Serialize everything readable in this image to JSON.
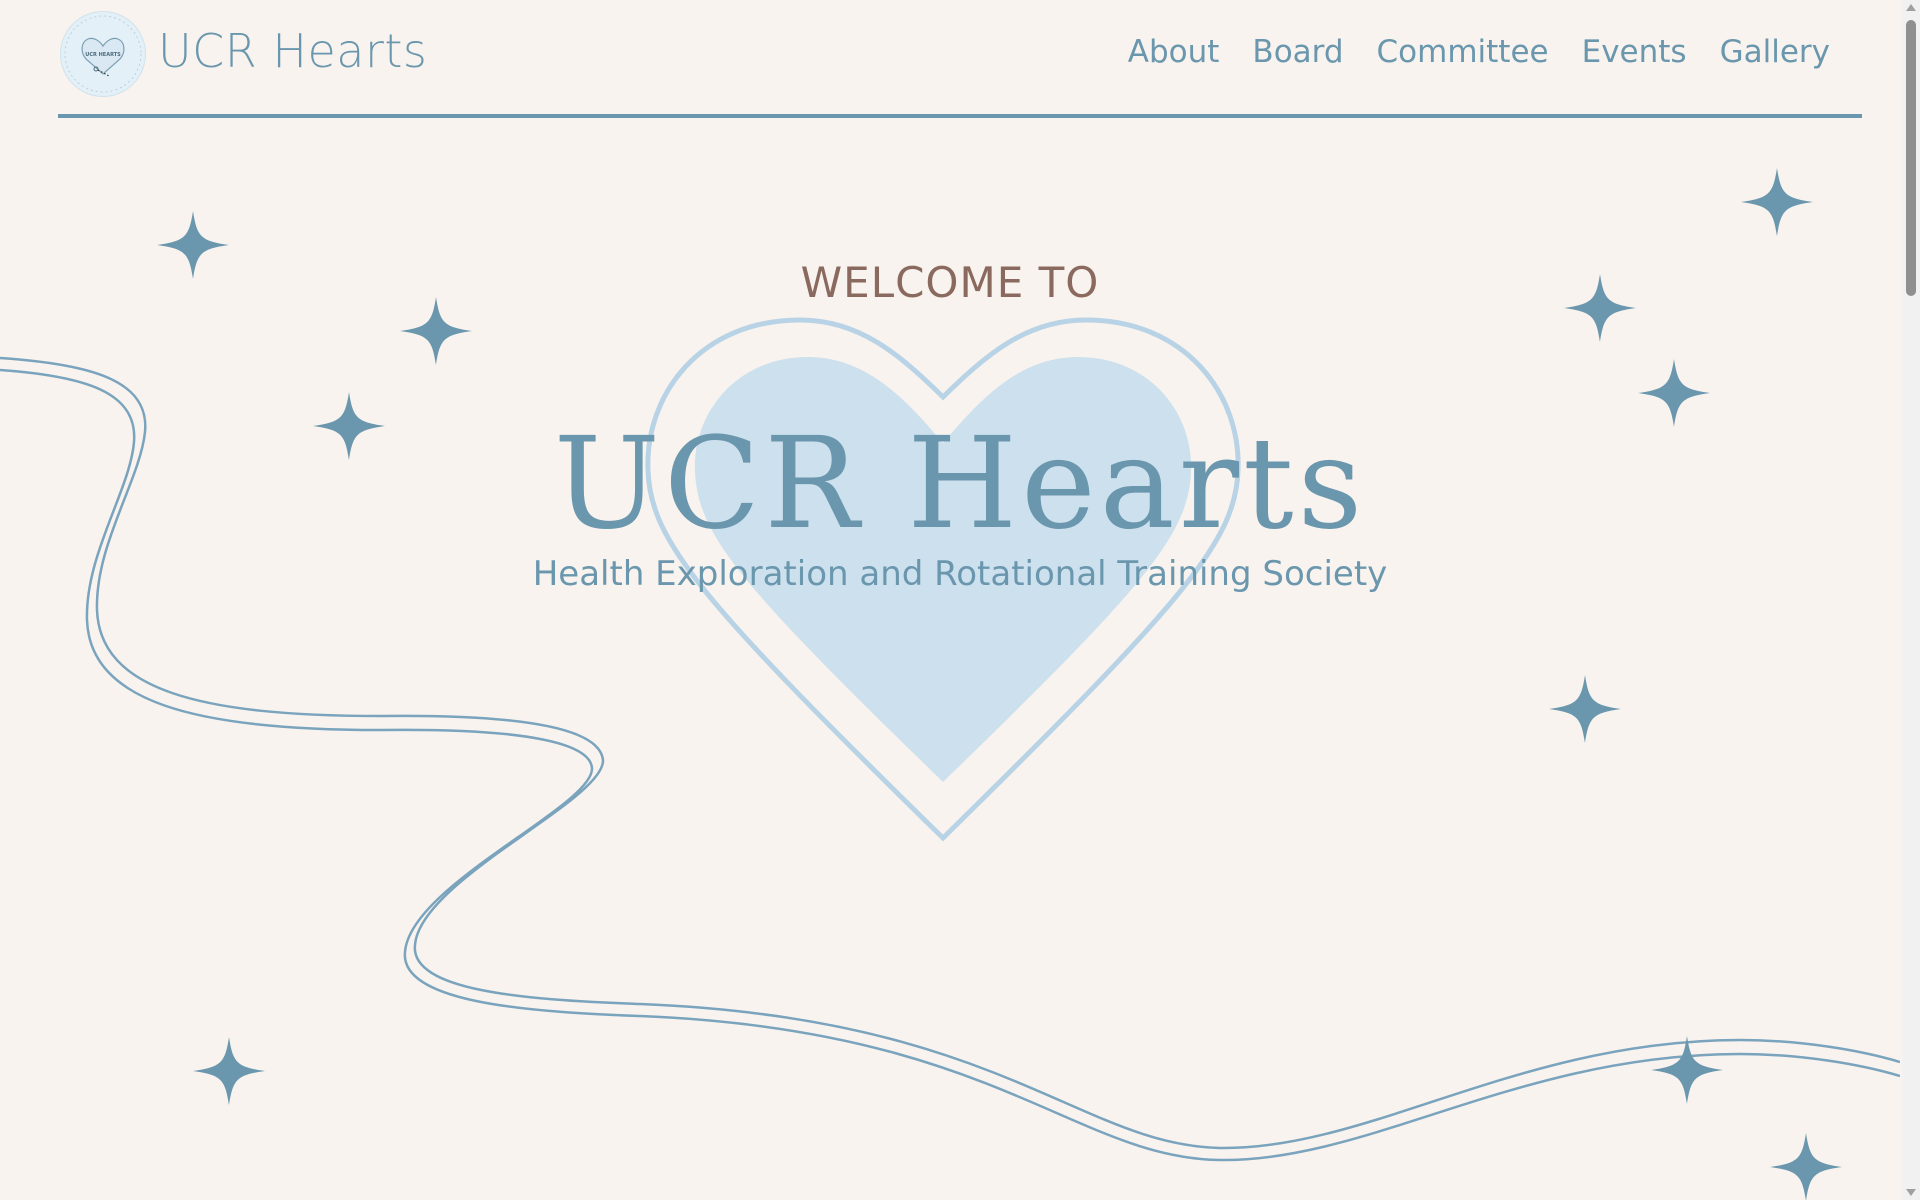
{
  "header": {
    "site_title": "UCR Hearts",
    "logo_text": "UCR HEARTS",
    "nav": [
      {
        "label": "About"
      },
      {
        "label": "Board"
      },
      {
        "label": "Committee"
      },
      {
        "label": "Events"
      },
      {
        "label": "Gallery"
      }
    ]
  },
  "hero": {
    "welcome": "WELCOME TO",
    "title": "UCR Hearts",
    "subtitle": "Health Exploration and Rotational Training Society"
  },
  "colors": {
    "background": "#f8f3ee",
    "accent": "#6a97ad",
    "welcome_text": "#8a6a5e",
    "heart_fill": "#cde0ee",
    "heart_outline": "#b9d3e6"
  },
  "icons": {
    "logo": "heart-stethoscope-icon",
    "decoration": "sparkle-star-icon"
  }
}
